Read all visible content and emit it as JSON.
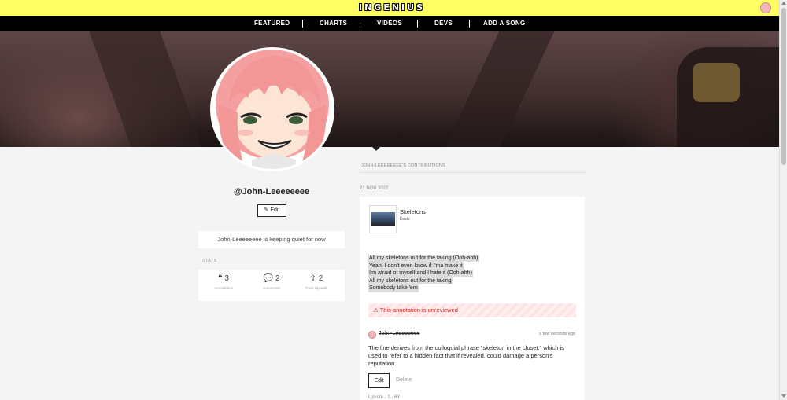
{
  "header": {
    "logo": "INGENIUS"
  },
  "nav": {
    "items": [
      "FEATURED",
      "CHARTS",
      "VIDEOS",
      "DEVS",
      "ADD A SONG"
    ]
  },
  "profile": {
    "username": "@John-Leeeeeeee",
    "edit_label": "Edit",
    "bio": "John-Leeeeeeee is keeping quiet for now",
    "stats_label": "STATS",
    "stats": [
      {
        "icon": "quote-icon",
        "value": "3",
        "label": "Annotations"
      },
      {
        "icon": "comment-icon",
        "value": "2",
        "label": "Comments"
      },
      {
        "icon": "upload-icon",
        "value": "2",
        "label": "Track Uploads"
      }
    ]
  },
  "contributions": {
    "title": "JOHN-LEEEEEEEE'S CONTRIBUTIONS",
    "date": "21 NOV 2022",
    "song": {
      "title": "Skeletons",
      "artist": "Keshi"
    },
    "lyrics": [
      "All my skeletons out for the taking (Ooh-ahh)",
      "Yeah, I don't even know if I'ma make it",
      "I'm afraid of myself and I hate it (Ooh-ahh)",
      "All my skeletons out for the taking",
      "Somebody take 'em"
    ],
    "unreviewed_notice": "This annotation is unreviewed",
    "annotation": {
      "user": "John-Leeeeeeee",
      "time": "a few seconds ago",
      "body": "The line derives from the colloquial phrase “skeleton in the closet,” which is used to refer to a hidden fact that if revealed, could damage a person's reputation.",
      "edit_label": "Edit",
      "delete_label": "Delete",
      "upvote_label": "Upvote · 1 · 6Y"
    }
  },
  "colors": {
    "topbar": "#ffff64",
    "nav": "#000000",
    "warning": "#dd2222"
  }
}
